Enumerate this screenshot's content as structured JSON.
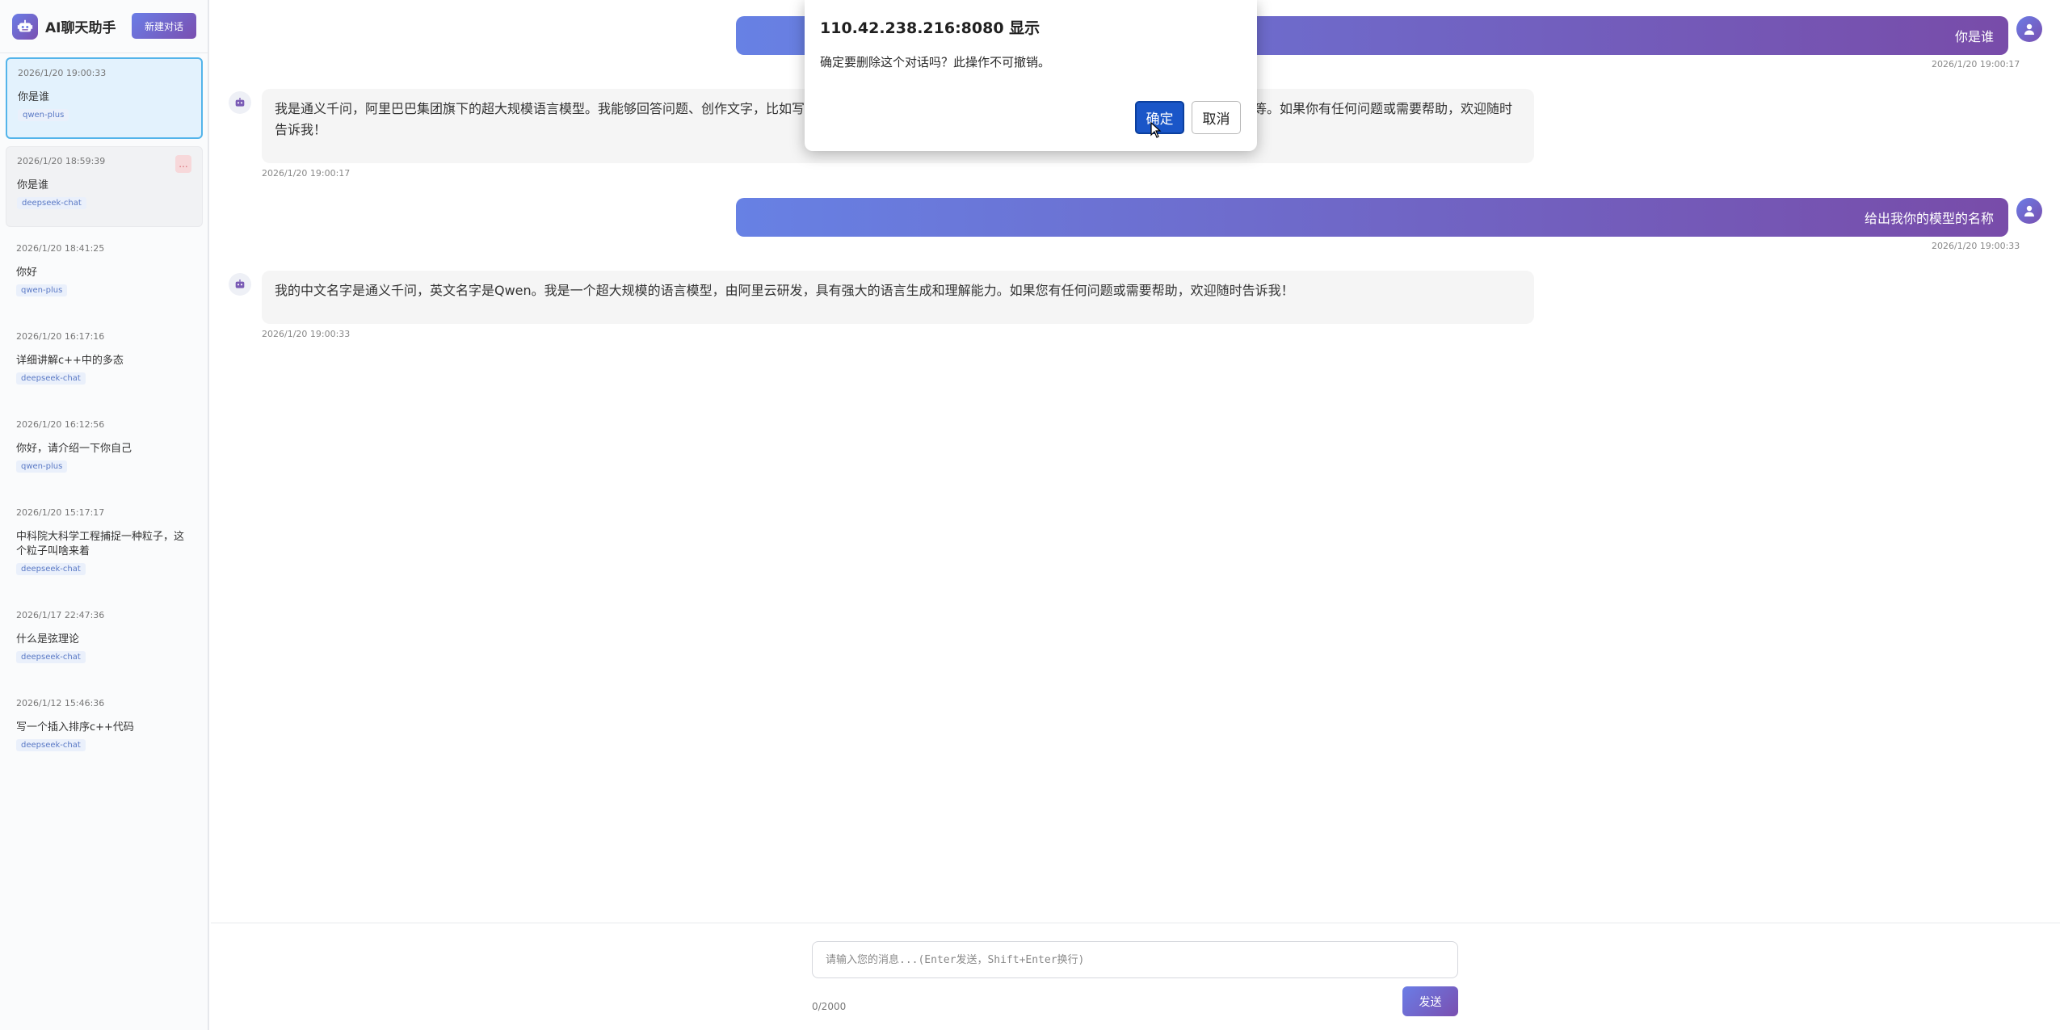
{
  "app": {
    "title": "AI聊天助手",
    "new_chat_label": "新建对话"
  },
  "sidebar": {
    "conversations": [
      {
        "time": "2026/1/20 19:00:33",
        "title": "你是谁",
        "model": "qwen-plus",
        "state": "active"
      },
      {
        "time": "2026/1/20 18:59:39",
        "title": "你是谁",
        "model": "deepseek-chat",
        "state": "hovered",
        "more_label": "..."
      },
      {
        "time": "2026/1/20 18:41:25",
        "title": "你好",
        "model": "qwen-plus"
      },
      {
        "time": "2026/1/20 16:17:16",
        "title": "详细讲解c++中的多态",
        "model": "deepseek-chat"
      },
      {
        "time": "2026/1/20 16:12:56",
        "title": "你好，请介绍一下你自己",
        "model": "qwen-plus"
      },
      {
        "time": "2026/1/20 15:17:17",
        "title": "中科院大科学工程捕捉一种粒子，这个粒子叫啥来着",
        "model": "deepseek-chat"
      },
      {
        "time": "2026/1/17 22:47:36",
        "title": "什么是弦理论",
        "model": "deepseek-chat"
      },
      {
        "time": "2026/1/12 15:46:36",
        "title": "写一个插入排序c++代码",
        "model": "deepseek-chat"
      }
    ]
  },
  "messages": [
    {
      "role": "user",
      "text": "你是谁",
      "time": "2026/1/20 19:00:17"
    },
    {
      "role": "assistant",
      "text_line1": "我是通义千问，阿里巴巴集团旗下的超大规模语言模型。我能够回答问题、创作文字，比如写",
      "text_line1_tail": "等。如果你有任何问题或需要帮助，欢迎随时",
      "text_line2": "告诉我！",
      "time": "2026/1/20 19:00:17"
    },
    {
      "role": "user",
      "text": "给出我你的模型的名称",
      "time": "2026/1/20 19:00:33"
    },
    {
      "role": "assistant",
      "text": "我的中文名字是通义千问，英文名字是Qwen。我是一个超大规模的语言模型，由阿里云研发，具有强大的语言生成和理解能力。如果您有任何问题或需要帮助，欢迎随时告诉我！",
      "time": "2026/1/20 19:00:33"
    }
  ],
  "composer": {
    "placeholder": "请输入您的消息...(Enter发送，Shift+Enter换行)",
    "value": "",
    "counter": "0/2000",
    "send_label": "发送"
  },
  "dialog": {
    "title": "110.42.238.216:8080 显示",
    "message": "确定要删除这个对话吗？此操作不可撤销。",
    "ok_label": "确定",
    "cancel_label": "取消"
  },
  "colors": {
    "accent_start": "#6781e4",
    "accent_end": "#784ca9",
    "active_conv_bg": "#e3f2fd",
    "active_conv_border": "#53b4ea",
    "dialog_ok": "#1a56c8"
  },
  "icons": {
    "logo": "robot-icon",
    "user_avatar": "user-icon",
    "ai_avatar": "robot-icon",
    "cursor": "mouse-pointer-icon"
  }
}
